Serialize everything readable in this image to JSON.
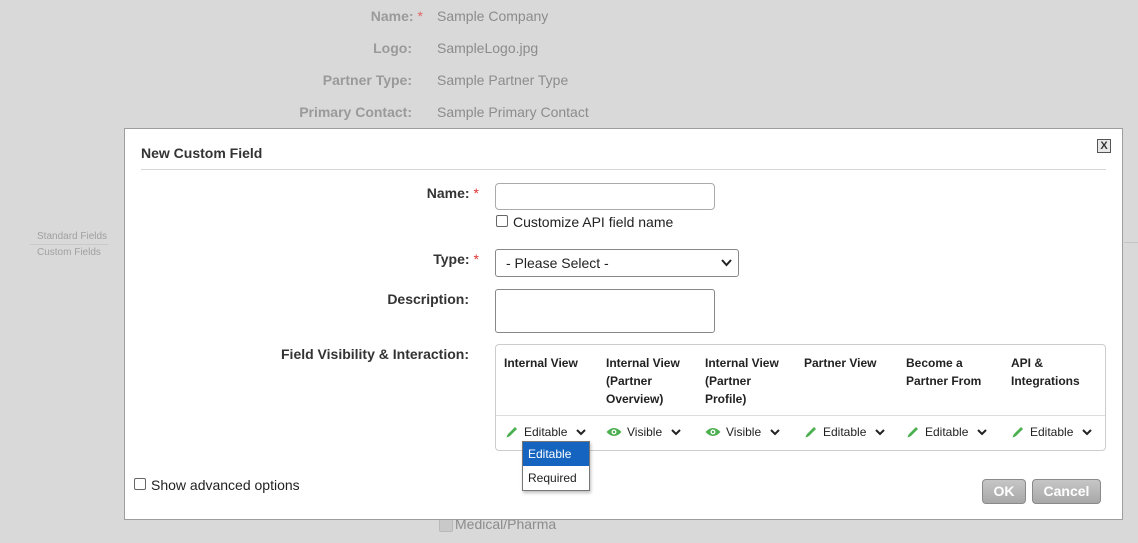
{
  "background": {
    "fields": [
      {
        "label": "Name:",
        "value": "Sample Company",
        "required": "*"
      },
      {
        "label": "Logo:",
        "value": "SampleLogo.jpg"
      },
      {
        "label": "Partner Type:",
        "value": "Sample Partner Type"
      },
      {
        "label": "Primary Contact:",
        "value": "Sample Primary Contact"
      }
    ],
    "sidebar": [
      "Standard Fields",
      "Custom Fields"
    ],
    "checkbox_label": "Medical/Pharma"
  },
  "modal": {
    "title": "New Custom Field",
    "close_label": "X",
    "name_label": "Name:",
    "required_mark": "*",
    "name_value": "",
    "customize_api_label": "Customize API field name",
    "type_label": "Type:",
    "type_selected": "- Please Select -",
    "description_label": "Description:",
    "description_value": "",
    "visibility_label": "Field Visibility & Interaction:",
    "columns": [
      {
        "header": "Internal View",
        "value": "Editable",
        "icon": "pencil-icon"
      },
      {
        "header": "Internal View\n(Partner\nOverview)",
        "value": "Visible",
        "icon": "eye-icon"
      },
      {
        "header": "Internal View\n(Partner\nProfile)",
        "value": "Visible",
        "icon": "eye-icon"
      },
      {
        "header": "Partner View",
        "value": "Editable",
        "icon": "pencil-icon"
      },
      {
        "header": "Become a\nPartner From",
        "value": "Editable",
        "icon": "pencil-icon"
      },
      {
        "header": "API &\nIntegrations",
        "value": "Editable",
        "icon": "pencil-icon"
      }
    ],
    "dropdown_options": [
      "Editable",
      "Required"
    ],
    "dropdown_selected": "Editable",
    "advanced_label": "Show advanced options",
    "ok_label": "OK",
    "cancel_label": "Cancel"
  },
  "colors": {
    "icon_green": "#4caf50",
    "selected_blue": "#1565c0",
    "required_red": "#dd3333"
  }
}
